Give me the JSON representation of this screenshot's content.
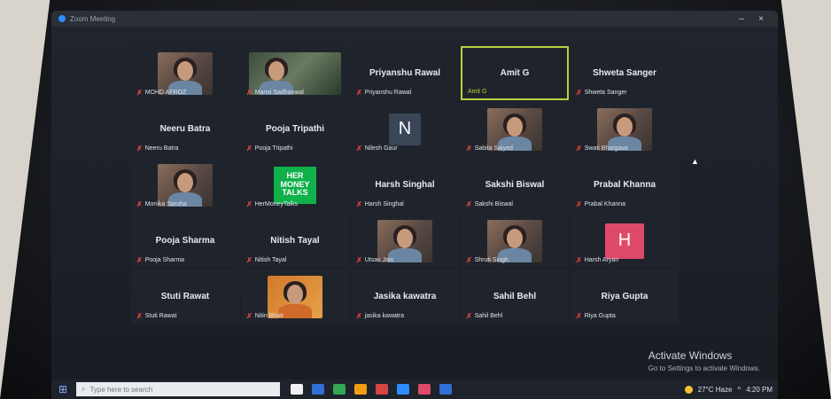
{
  "window": {
    "title": "Zoom Meeting",
    "controls": [
      "–",
      "×"
    ]
  },
  "participants": [
    {
      "display": "video",
      "label": "MOHD AFROZ",
      "muted": true
    },
    {
      "display": "video-wide",
      "label": "Mansi Sadhanwal",
      "muted": true
    },
    {
      "display": "name",
      "name": "Priyanshu Rawal",
      "label": "Priyanshu Rawal",
      "muted": true
    },
    {
      "display": "name",
      "name": "Amit G",
      "label": "Amit G",
      "muted": false,
      "active": true
    },
    {
      "display": "name",
      "name": "Shweta Sanger",
      "label": "Shweta Sanger",
      "muted": true
    },
    {
      "display": "name",
      "name": "Neeru Batra",
      "label": "Neeru Batra",
      "muted": true
    },
    {
      "display": "name",
      "name": "Pooja Tripathi",
      "label": "Pooja Tripathi",
      "muted": true
    },
    {
      "display": "avatar-letter",
      "letter": "N",
      "label": "Nilesh Gaur",
      "muted": true
    },
    {
      "display": "video",
      "label": "Sabita Saiyed",
      "muted": true
    },
    {
      "display": "video",
      "label": "Swati Bhargava",
      "muted": true
    },
    {
      "display": "video",
      "label": "Monika Saroha",
      "muted": true
    },
    {
      "display": "logo",
      "logo_text": [
        "HER",
        "MONEY",
        "TALKS"
      ],
      "label": "HerMoneyTalks",
      "muted": true
    },
    {
      "display": "name",
      "name": "Harsh Singhal",
      "label": "Harsh Singhal",
      "muted": true
    },
    {
      "display": "name",
      "name": "Sakshi Biswal",
      "label": "Sakshi Biswal",
      "muted": true
    },
    {
      "display": "name",
      "name": "Prabal Khanna",
      "label": "Prabal Khanna",
      "muted": true
    },
    {
      "display": "name",
      "name": "Pooja Sharma",
      "label": "Pooja Sharma",
      "muted": true
    },
    {
      "display": "name",
      "name": "Nitish Tayal",
      "label": "Nitish Tayal",
      "muted": true
    },
    {
      "display": "video",
      "label": "Utsav Jain",
      "muted": true
    },
    {
      "display": "video",
      "label": "Shruti Singh",
      "muted": true
    },
    {
      "display": "avatar-letter",
      "letter": "H",
      "label": "Harsh Aryan",
      "muted": true
    },
    {
      "display": "name",
      "name": "Stuti Rawat",
      "label": "Stuti Rawat",
      "muted": true
    },
    {
      "display": "video-orange",
      "label": "Nitin Bhatt",
      "muted": true
    },
    {
      "display": "name",
      "name": "Jasika kawatra",
      "label": "jasika kawatra",
      "muted": true
    },
    {
      "display": "name",
      "name": "Sahil Behl",
      "label": "Sahil Behl",
      "muted": true
    },
    {
      "display": "name",
      "name": "Riya Gupta",
      "label": "Riya Gupta",
      "muted": true
    }
  ],
  "activation": {
    "title": "Activate Windows",
    "subtitle": "Go to Settings to activate Windows."
  },
  "taskbar": {
    "search_placeholder": "Type here to search",
    "weather": "27°C  Haze",
    "time": "4:20 PM",
    "app_colors": [
      "#f0f0f0",
      "#2f6fd6",
      "#33a852",
      "#f39c12",
      "#d64545",
      "#2d8cff",
      "#e04a6a",
      "#2f6fd6"
    ]
  },
  "colors": {
    "accent_active": "#b7d23a",
    "muted_mic": "#e6423a",
    "logo_green": "#10b04a"
  }
}
